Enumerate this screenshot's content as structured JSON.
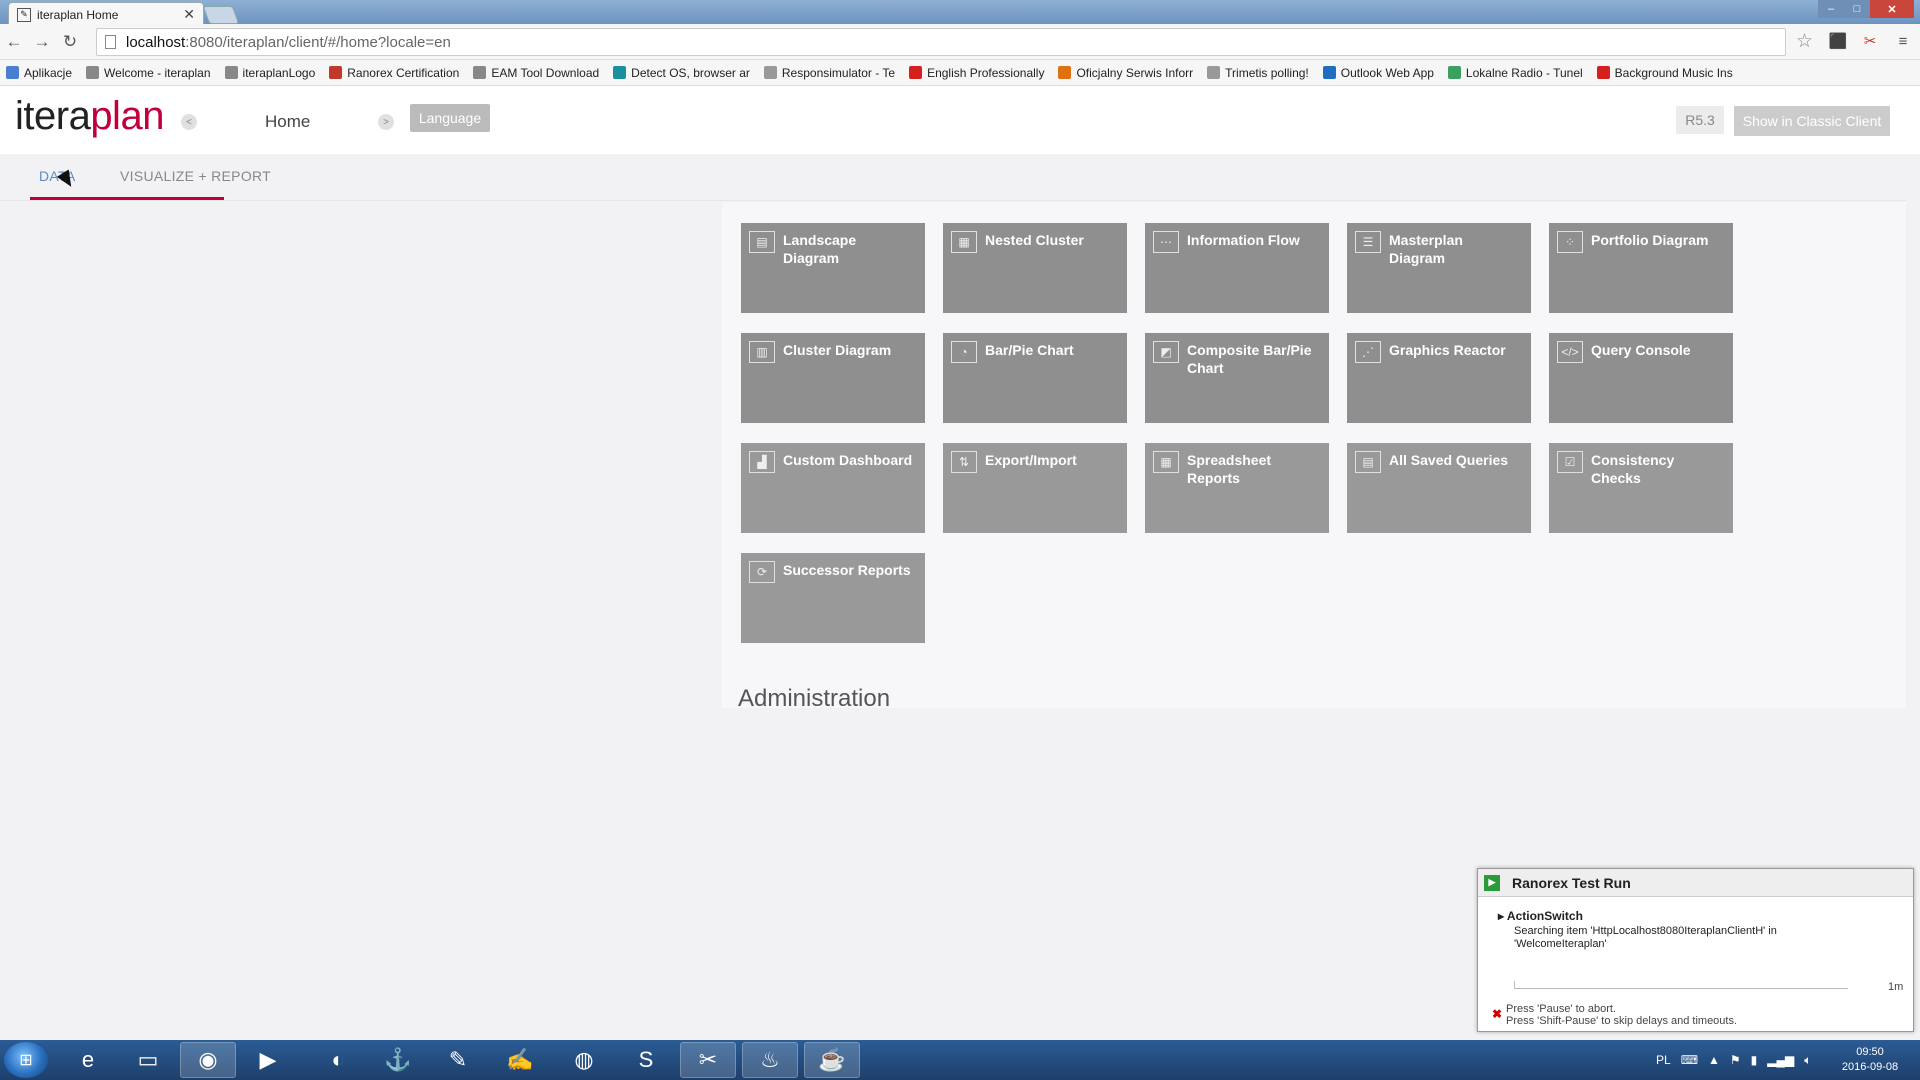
{
  "browser": {
    "tab_title": "iteraplan Home",
    "url_host": "localhost",
    "url_rest": ":8080/iteraplan/client/#/home?locale=en",
    "bookmarks": [
      {
        "label": "Aplikacje",
        "color": "#4a7fcf"
      },
      {
        "label": "Welcome - iteraplan",
        "color": "#888888"
      },
      {
        "label": "iteraplanLogo",
        "color": "#888888"
      },
      {
        "label": "Ranorex Certification",
        "color": "#c0392b"
      },
      {
        "label": "EAM Tool Download",
        "color": "#888888"
      },
      {
        "label": "Detect OS, browser ar",
        "color": "#1a8fa0"
      },
      {
        "label": "Responsimulator - Te",
        "color": "#999999"
      },
      {
        "label": "English Professionally",
        "color": "#d62020"
      },
      {
        "label": "Oficjalny Serwis Inforr",
        "color": "#e07010"
      },
      {
        "label": "Trimetis polling!",
        "color": "#999999"
      },
      {
        "label": "Outlook Web App",
        "color": "#1f6fc0"
      },
      {
        "label": "Lokalne Radio - Tunel",
        "color": "#3aa060"
      },
      {
        "label": "Background Music Ins",
        "color": "#d62020"
      }
    ]
  },
  "app": {
    "logo_part1": "itera",
    "logo_part2": "plan",
    "breadcrumb": "Home",
    "language_button": "Language",
    "version": "R5.3",
    "classic_button": "Show in Classic Client",
    "tabs": [
      {
        "label": "DATA"
      },
      {
        "label": "VISUALIZE + REPORT"
      }
    ],
    "tiles_row1": [
      {
        "label": "Landscape Diagram",
        "icon": "landscape-icon"
      },
      {
        "label": "Nested Cluster",
        "icon": "nested-cluster-icon"
      },
      {
        "label": "Information Flow",
        "icon": "information-flow-icon"
      },
      {
        "label": "Masterplan Diagram",
        "icon": "masterplan-icon"
      },
      {
        "label": "Portfolio Diagram",
        "icon": "portfolio-icon"
      }
    ],
    "tiles_row2": [
      {
        "label": "Cluster Diagram",
        "icon": "cluster-icon"
      },
      {
        "label": "Bar/Pie Chart",
        "icon": "pie-chart-icon"
      },
      {
        "label": "Composite Bar/Pie Chart",
        "icon": "composite-chart-icon"
      },
      {
        "label": "Graphics Reactor",
        "icon": "graphics-reactor-icon"
      },
      {
        "label": "Query Console",
        "icon": "code-icon"
      }
    ],
    "tiles_row3": [
      {
        "label": "Custom Dashboard",
        "icon": "dashboard-icon"
      },
      {
        "label": "Export/Import",
        "icon": "export-import-icon"
      },
      {
        "label": "Spreadsheet Reports",
        "icon": "spreadsheet-icon"
      },
      {
        "label": "All Saved Queries",
        "icon": "saved-queries-icon"
      },
      {
        "label": "Consistency Checks",
        "icon": "checklist-icon"
      }
    ],
    "tiles_row4": [
      {
        "label": "Successor Reports",
        "icon": "successor-icon"
      }
    ],
    "admin_heading": "Administration"
  },
  "ranorex": {
    "title": "Ranorex Test Run",
    "action": "ActionSwitch",
    "message": "Searching item 'HttpLocalhost8080IteraplanClientH' in 'WelcomeIteraplan'",
    "time": "1m",
    "hint_line1": "Press 'Pause' to abort.",
    "hint_line2": "Press 'Shift-Pause' to skip delays and timeouts."
  },
  "taskbar": {
    "language": "PL",
    "time": "09:50",
    "date": "2016-09-08"
  },
  "colors": {
    "brand": "#c0003c",
    "tile": "#8f8f8f"
  }
}
